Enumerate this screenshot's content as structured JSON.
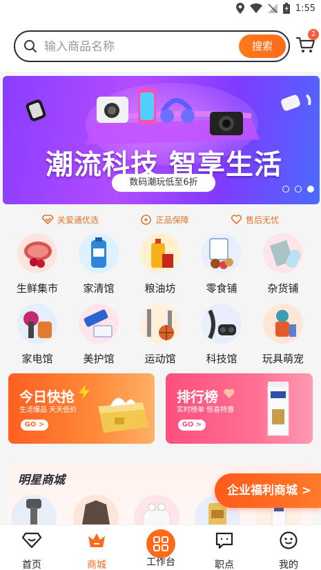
{
  "status_bar": {
    "time": "1:55"
  },
  "search": {
    "placeholder": "输入商品名称",
    "button_label": "搜索"
  },
  "cart": {
    "badge_count": "2"
  },
  "banner": {
    "headline": "潮流科技 智享生活",
    "pill_text": "数码潮玩低至6折",
    "total_slides": 3,
    "active_slide": 3
  },
  "guarantees": [
    {
      "label": "关爱通优选",
      "icon": "badge-diamond-icon"
    },
    {
      "label": "正品保障",
      "icon": "seal-icon"
    },
    {
      "label": "售后无忧",
      "icon": "heart-shield-icon"
    }
  ],
  "categories": [
    {
      "label": "生鲜集市",
      "icon": "meat-cherry-icon"
    },
    {
      "label": "家清馆",
      "icon": "cleaning-bottle-icon"
    },
    {
      "label": "粮油坊",
      "icon": "oil-bottle-icon"
    },
    {
      "label": "零食铺",
      "icon": "snack-box-icon"
    },
    {
      "label": "杂货铺",
      "icon": "storage-bag-icon"
    },
    {
      "label": "家电馆",
      "icon": "hair-dryer-icon"
    },
    {
      "label": "美护馆",
      "icon": "toothpaste-icon"
    },
    {
      "label": "运动馆",
      "icon": "basketball-icon"
    },
    {
      "label": "科技馆",
      "icon": "earbuds-icon"
    },
    {
      "label": "玩具萌宠",
      "icon": "toy-figure-icon"
    }
  ],
  "promos": {
    "left": {
      "title": "今日快抢",
      "subtitle": "生活爆品 天天低价",
      "go": "GO >"
    },
    "right": {
      "title": "排行榜",
      "subtitle": "实时榜单 惊喜特惠",
      "go": "GO >"
    }
  },
  "star_mall": {
    "title": "明星商城"
  },
  "enterprise_button": {
    "label": "企业福利商城 >"
  },
  "bottom_nav": [
    {
      "label": "首页",
      "icon": "home-diamond-icon",
      "active": false
    },
    {
      "label": "商城",
      "icon": "crown-icon",
      "active": true
    },
    {
      "label": "工作台",
      "icon": "grid-icon",
      "active": false
    },
    {
      "label": "职点",
      "icon": "chat-icon",
      "active": false
    },
    {
      "label": "我的",
      "icon": "smile-icon",
      "active": false
    }
  ],
  "colors": {
    "accent": "#ff6a1a",
    "banner_purple": "#8a3dff",
    "guarantee_text": "#e0742a",
    "promo_pink": "#ff4f7e"
  }
}
